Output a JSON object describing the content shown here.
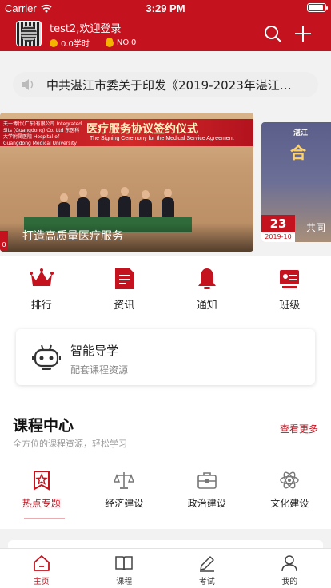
{
  "status_bar": {
    "carrier": "Carrier",
    "time": "3:29 PM",
    "battery_level": 0.9
  },
  "header": {
    "greeting": "test2,欢迎登录",
    "hours": "0.0学时",
    "rank": "NO.0",
    "search_icon": "search-icon",
    "add_icon": "plus-icon"
  },
  "notice": {
    "icon": "speaker-icon",
    "text": "中共湛江市委关于印发《2019-2023年湛江市..."
  },
  "carousel": {
    "main": {
      "banner_title": "医疗服务协议签约仪式",
      "banner_subtitle": "The Signing Ceremony for the Medical Service Agreement",
      "banner_org": "天一博什(广东)有限公司 Integrated Sits (Guangdong) Co. Ltd 东医科大学附属医院 Hospital of Guangdong Medical University",
      "caption": "打造高质量医疗服务",
      "index": "0"
    },
    "next": {
      "banner_head": "湛江",
      "banner_big": "合",
      "day": "23",
      "year_month": "2019-10",
      "caption": "共同"
    }
  },
  "quick_nav": [
    {
      "label": "排行",
      "icon": "crown-icon"
    },
    {
      "label": "资讯",
      "icon": "document-icon"
    },
    {
      "label": "通知",
      "icon": "bell-icon"
    },
    {
      "label": "班级",
      "icon": "class-icon"
    }
  ],
  "guide": {
    "title": "智能导学",
    "subtitle": "配套课程资源",
    "icon": "robot-icon"
  },
  "course_center": {
    "title": "课程中心",
    "subtitle": "全方位的课程资源，轻松学习",
    "more": "查看更多",
    "categories": [
      {
        "label": "热点专题",
        "icon": "star-badge-icon",
        "active": true
      },
      {
        "label": "经济建设",
        "icon": "scale-icon",
        "active": false
      },
      {
        "label": "政治建设",
        "icon": "briefcase-icon",
        "active": false
      },
      {
        "label": "文化建设",
        "icon": "atom-icon",
        "active": false
      }
    ]
  },
  "tabbar": [
    {
      "label": "主页",
      "icon": "home-icon",
      "active": true
    },
    {
      "label": "课程",
      "icon": "book-icon",
      "active": false
    },
    {
      "label": "考试",
      "icon": "pencil-icon",
      "active": false
    },
    {
      "label": "我的",
      "icon": "profile-icon",
      "active": false
    }
  ],
  "colors": {
    "brand": "#c4121e",
    "background": "#f2f2f2",
    "gold": "#f5b400"
  }
}
